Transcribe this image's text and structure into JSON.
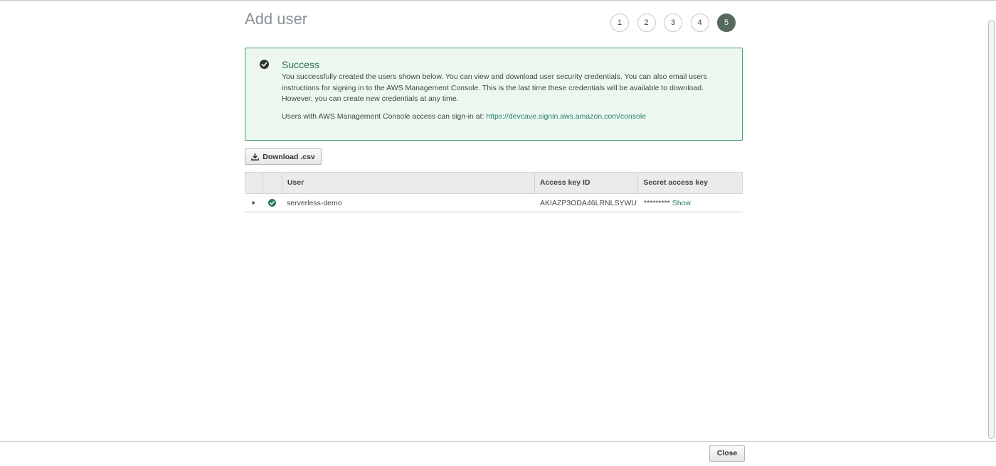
{
  "page": {
    "title": "Add user"
  },
  "steps": [
    "1",
    "2",
    "3",
    "4",
    "5"
  ],
  "success": {
    "title": "Success",
    "body": "You successfully created the users shown below. You can view and download user security credentials. You can also email users instructions for signing in to the AWS Management Console. This is the last time these credentials will be available to download. However, you can create new credentials at any time.",
    "console_prefix": "Users with AWS Management Console access can sign-in at: ",
    "console_url": "https://devcave.signin.aws.amazon.com/console"
  },
  "toolbar": {
    "download_label": "Download .csv"
  },
  "table": {
    "headers": {
      "user": "User",
      "access_key": "Access key ID",
      "secret_key": "Secret access key"
    },
    "rows": [
      {
        "user": "serverless-demo",
        "access_key": "AKIAZP3ODA46LRNLSYWU",
        "secret_masked": "*********",
        "show_label": "Show"
      }
    ]
  },
  "footer": {
    "close_label": "Close"
  },
  "colors": {
    "success_border": "#3e9b6a",
    "success_bg": "#ecf8ef",
    "link": "#2a7f6d",
    "active_step": "#55695e"
  },
  "icons": {
    "success": "check-circle-icon",
    "download": "download-icon",
    "expand": "caret-right-icon",
    "row_status": "check-circle-icon"
  }
}
